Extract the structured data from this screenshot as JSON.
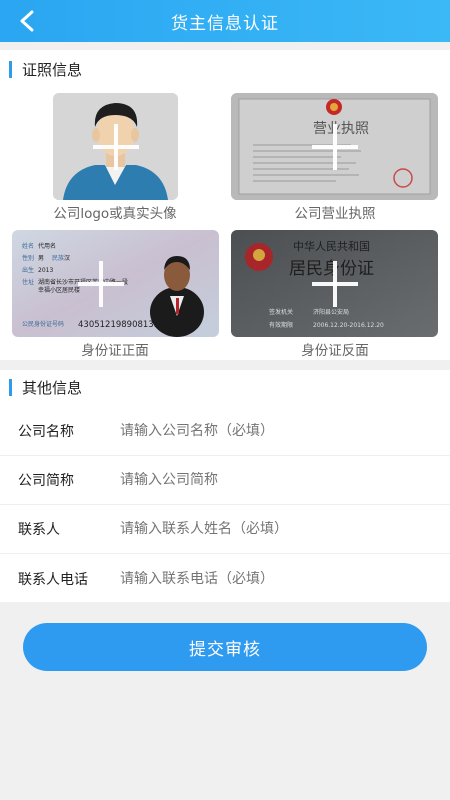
{
  "header": {
    "title": "货主信息认证",
    "back_icon": "chevron-left-icon"
  },
  "license_section": {
    "title": "证照信息",
    "cards": [
      {
        "caption": "公司logo或真实头像"
      },
      {
        "caption": "公司营业执照",
        "image_text": "营业执照"
      },
      {
        "caption": "身份证正面",
        "image_text": [
          "姓名",
          "代用名",
          "性别",
          "男",
          "民族",
          "汉",
          "出生",
          "2013",
          "住址",
          "湖南省长沙市开福区芙蓉中路一段",
          "幸福小区居民楼",
          "公民身份证号码",
          "430512198908131367"
        ]
      },
      {
        "caption": "身份证反面",
        "image_text": [
          "中华人民共和国",
          "居民身份证",
          "签发机关",
          "济阳县公安局",
          "有效期限",
          "2006.12.20-2016.12.20"
        ]
      }
    ]
  },
  "other_section": {
    "title": "其他信息",
    "fields": [
      {
        "label": "公司名称",
        "placeholder": "请输入公司名称（必填）"
      },
      {
        "label": "公司简称",
        "placeholder": "请输入公司简称"
      },
      {
        "label": "联系人",
        "placeholder": "请输入联系人姓名（必填）"
      },
      {
        "label": "联系人电话",
        "placeholder": "请输入联系电话（必填）"
      }
    ]
  },
  "submit_label": "提交审核",
  "colors": {
    "header": "#2aa6f2",
    "accent": "#2f9bea",
    "button": "#2f9bf0"
  }
}
